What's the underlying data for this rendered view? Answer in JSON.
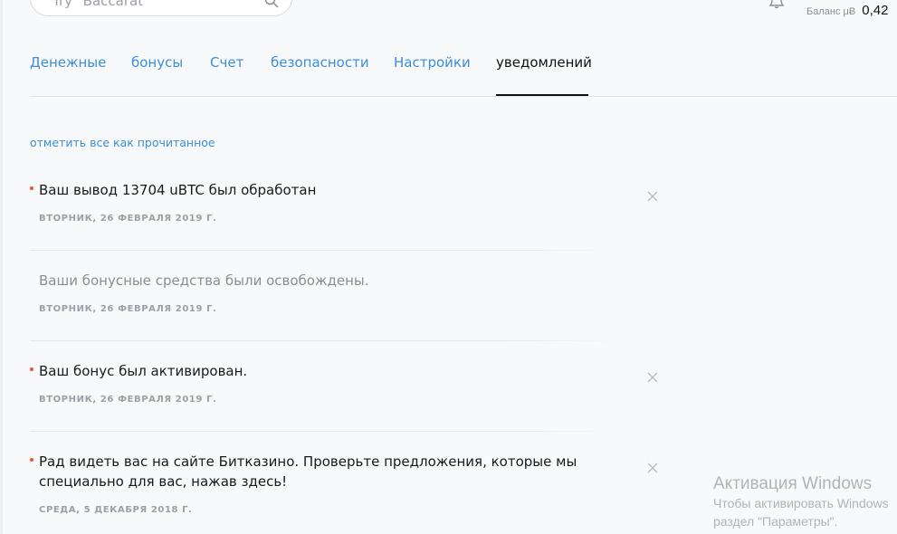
{
  "search": {
    "placeholder": "Try \"Baccarat\""
  },
  "balance": {
    "label": "Баланс μɃ",
    "value": "0,42"
  },
  "tabs": [
    {
      "label": "Денежные"
    },
    {
      "label": "бонусы"
    },
    {
      "label": "Счет"
    },
    {
      "label": "безопасности"
    },
    {
      "label": "Настройки"
    },
    {
      "label": "уведомлений",
      "active": true
    }
  ],
  "mark_all_label": "отметить все как прочитанное",
  "notifications": [
    {
      "text": "Ваш вывод 13704 uBTC был обработан",
      "date": "ВТОРНИК, 26 ФЕВРАЛЯ 2019 Г.",
      "unread": true
    },
    {
      "text": "Ваши бонусные средства были освобождены.",
      "date": "ВТОРНИК, 26 ФЕВРАЛЯ 2019 Г.",
      "unread": false
    },
    {
      "text": "Ваш бонус был активирован.",
      "date": "ВТОРНИК, 26 ФЕВРАЛЯ 2019 Г.",
      "unread": true
    },
    {
      "text": "Рад видеть вас на сайте Битказино. Проверьте предложения, которые мы специально для вас, нажав здесь!",
      "date": "СРЕДА, 5 ДЕКАБРЯ 2018 Г.",
      "unread": true
    }
  ],
  "watermark": {
    "title": "Активация Windows",
    "line1": "Чтобы активировать Windows",
    "line2": "раздел \"Параметры\"."
  },
  "colors": {
    "accent": "#3a8fd8",
    "unread_dot": "#e8582a",
    "text": "#1a1a1a",
    "muted": "#9aa0a6"
  }
}
